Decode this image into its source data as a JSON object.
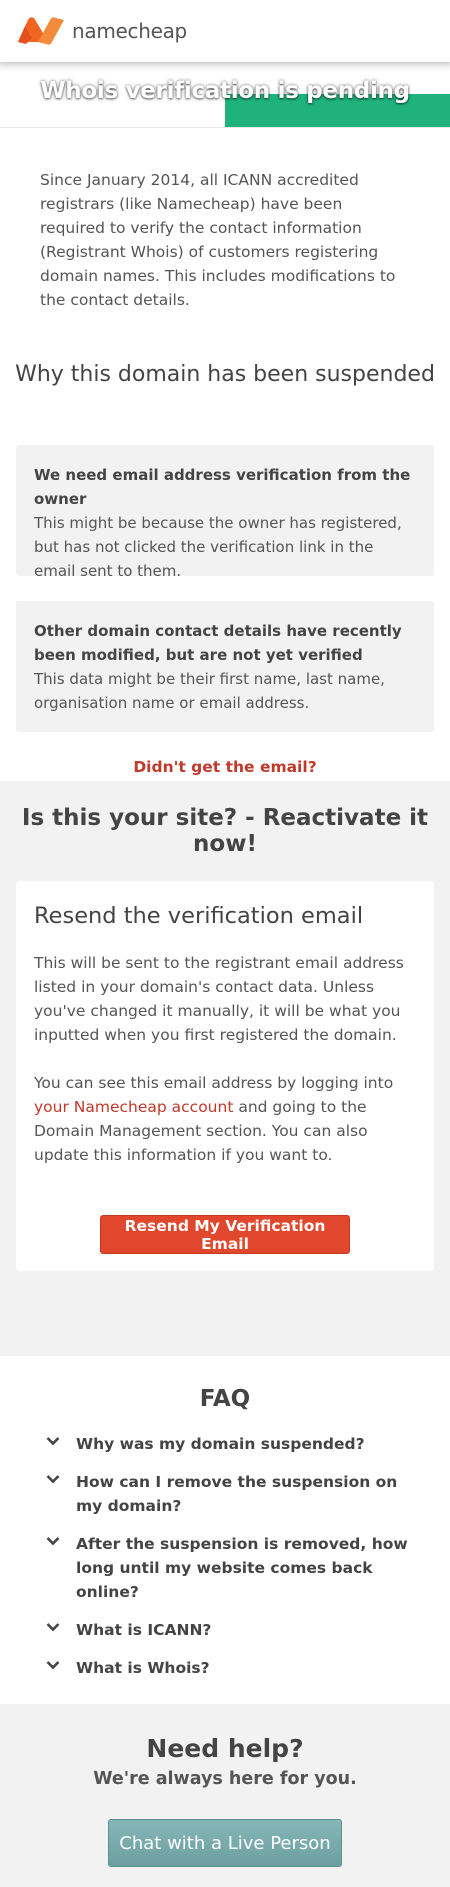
{
  "header": {
    "brand": "namecheap",
    "logo_icon": "namecheap-n-logo",
    "brand_color": "#f06522"
  },
  "banner": {
    "title": "Whois verification is pending",
    "accent_color": "#1fb27d"
  },
  "intro": {
    "text": "Since January 2014, all ICANN accredited registrars (like Namecheap) have been required to verify the contact information (Registrant Whois) of customers registering domain names. This includes modifications to the contact details."
  },
  "suspension": {
    "title": "Why this domain has been suspended",
    "reasons": [
      {
        "title": "We need email address verification from the owner",
        "text": "This might be because the owner has registered, but has not clicked the verification link in the email sent to them."
      },
      {
        "title": "Other domain contact details have recently been modified, but are not yet verified",
        "text": "This data might be their first name, last name, organisation name or email address."
      }
    ],
    "didnt_get_link": "Didn't get the email?",
    "link_color": "#c0392b"
  },
  "reactivate": {
    "title": "Is this your site? - Reactivate it now!",
    "card": {
      "heading": "Resend the verification email",
      "paragraph1": "This will be sent to the registrant email address listed in your domain's contact data. Unless you've changed it manually, it will be what you inputted when you first registered the domain.",
      "paragraph2_before": "You can see this email address by logging into ",
      "paragraph2_link": "your Namecheap account",
      "paragraph2_after": " and going to the Domain Management section. You can also update this information if you want to.",
      "button": "Resend My Verification Email",
      "button_color": "#e0472c"
    }
  },
  "faq": {
    "title": "FAQ",
    "items": [
      "Why was my domain suspended?",
      "How can I remove the suspension on my domain?",
      "After the suspension is removed, how long until my website comes back online?",
      "What is ICANN?",
      "What is Whois?"
    ],
    "chevron_icon": "chevron-down-icon"
  },
  "help": {
    "title": "Need help?",
    "subtitle": "We're always here for you.",
    "button": "Chat with a Live Person",
    "button_color": "#7aabad"
  }
}
